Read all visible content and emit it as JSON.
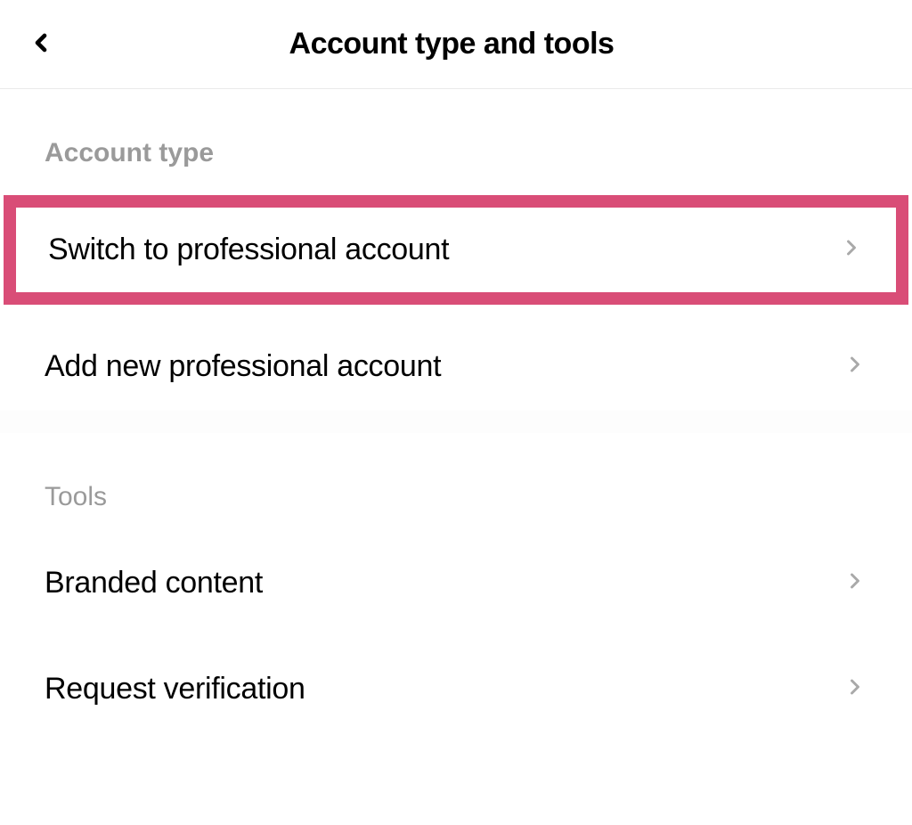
{
  "header": {
    "title": "Account type and tools"
  },
  "sections": {
    "account_type": {
      "header": "Account type",
      "items": [
        {
          "label": "Switch to professional account"
        },
        {
          "label": "Add new professional account"
        }
      ]
    },
    "tools": {
      "header": "Tools",
      "items": [
        {
          "label": "Branded content"
        },
        {
          "label": "Request verification"
        }
      ]
    }
  }
}
